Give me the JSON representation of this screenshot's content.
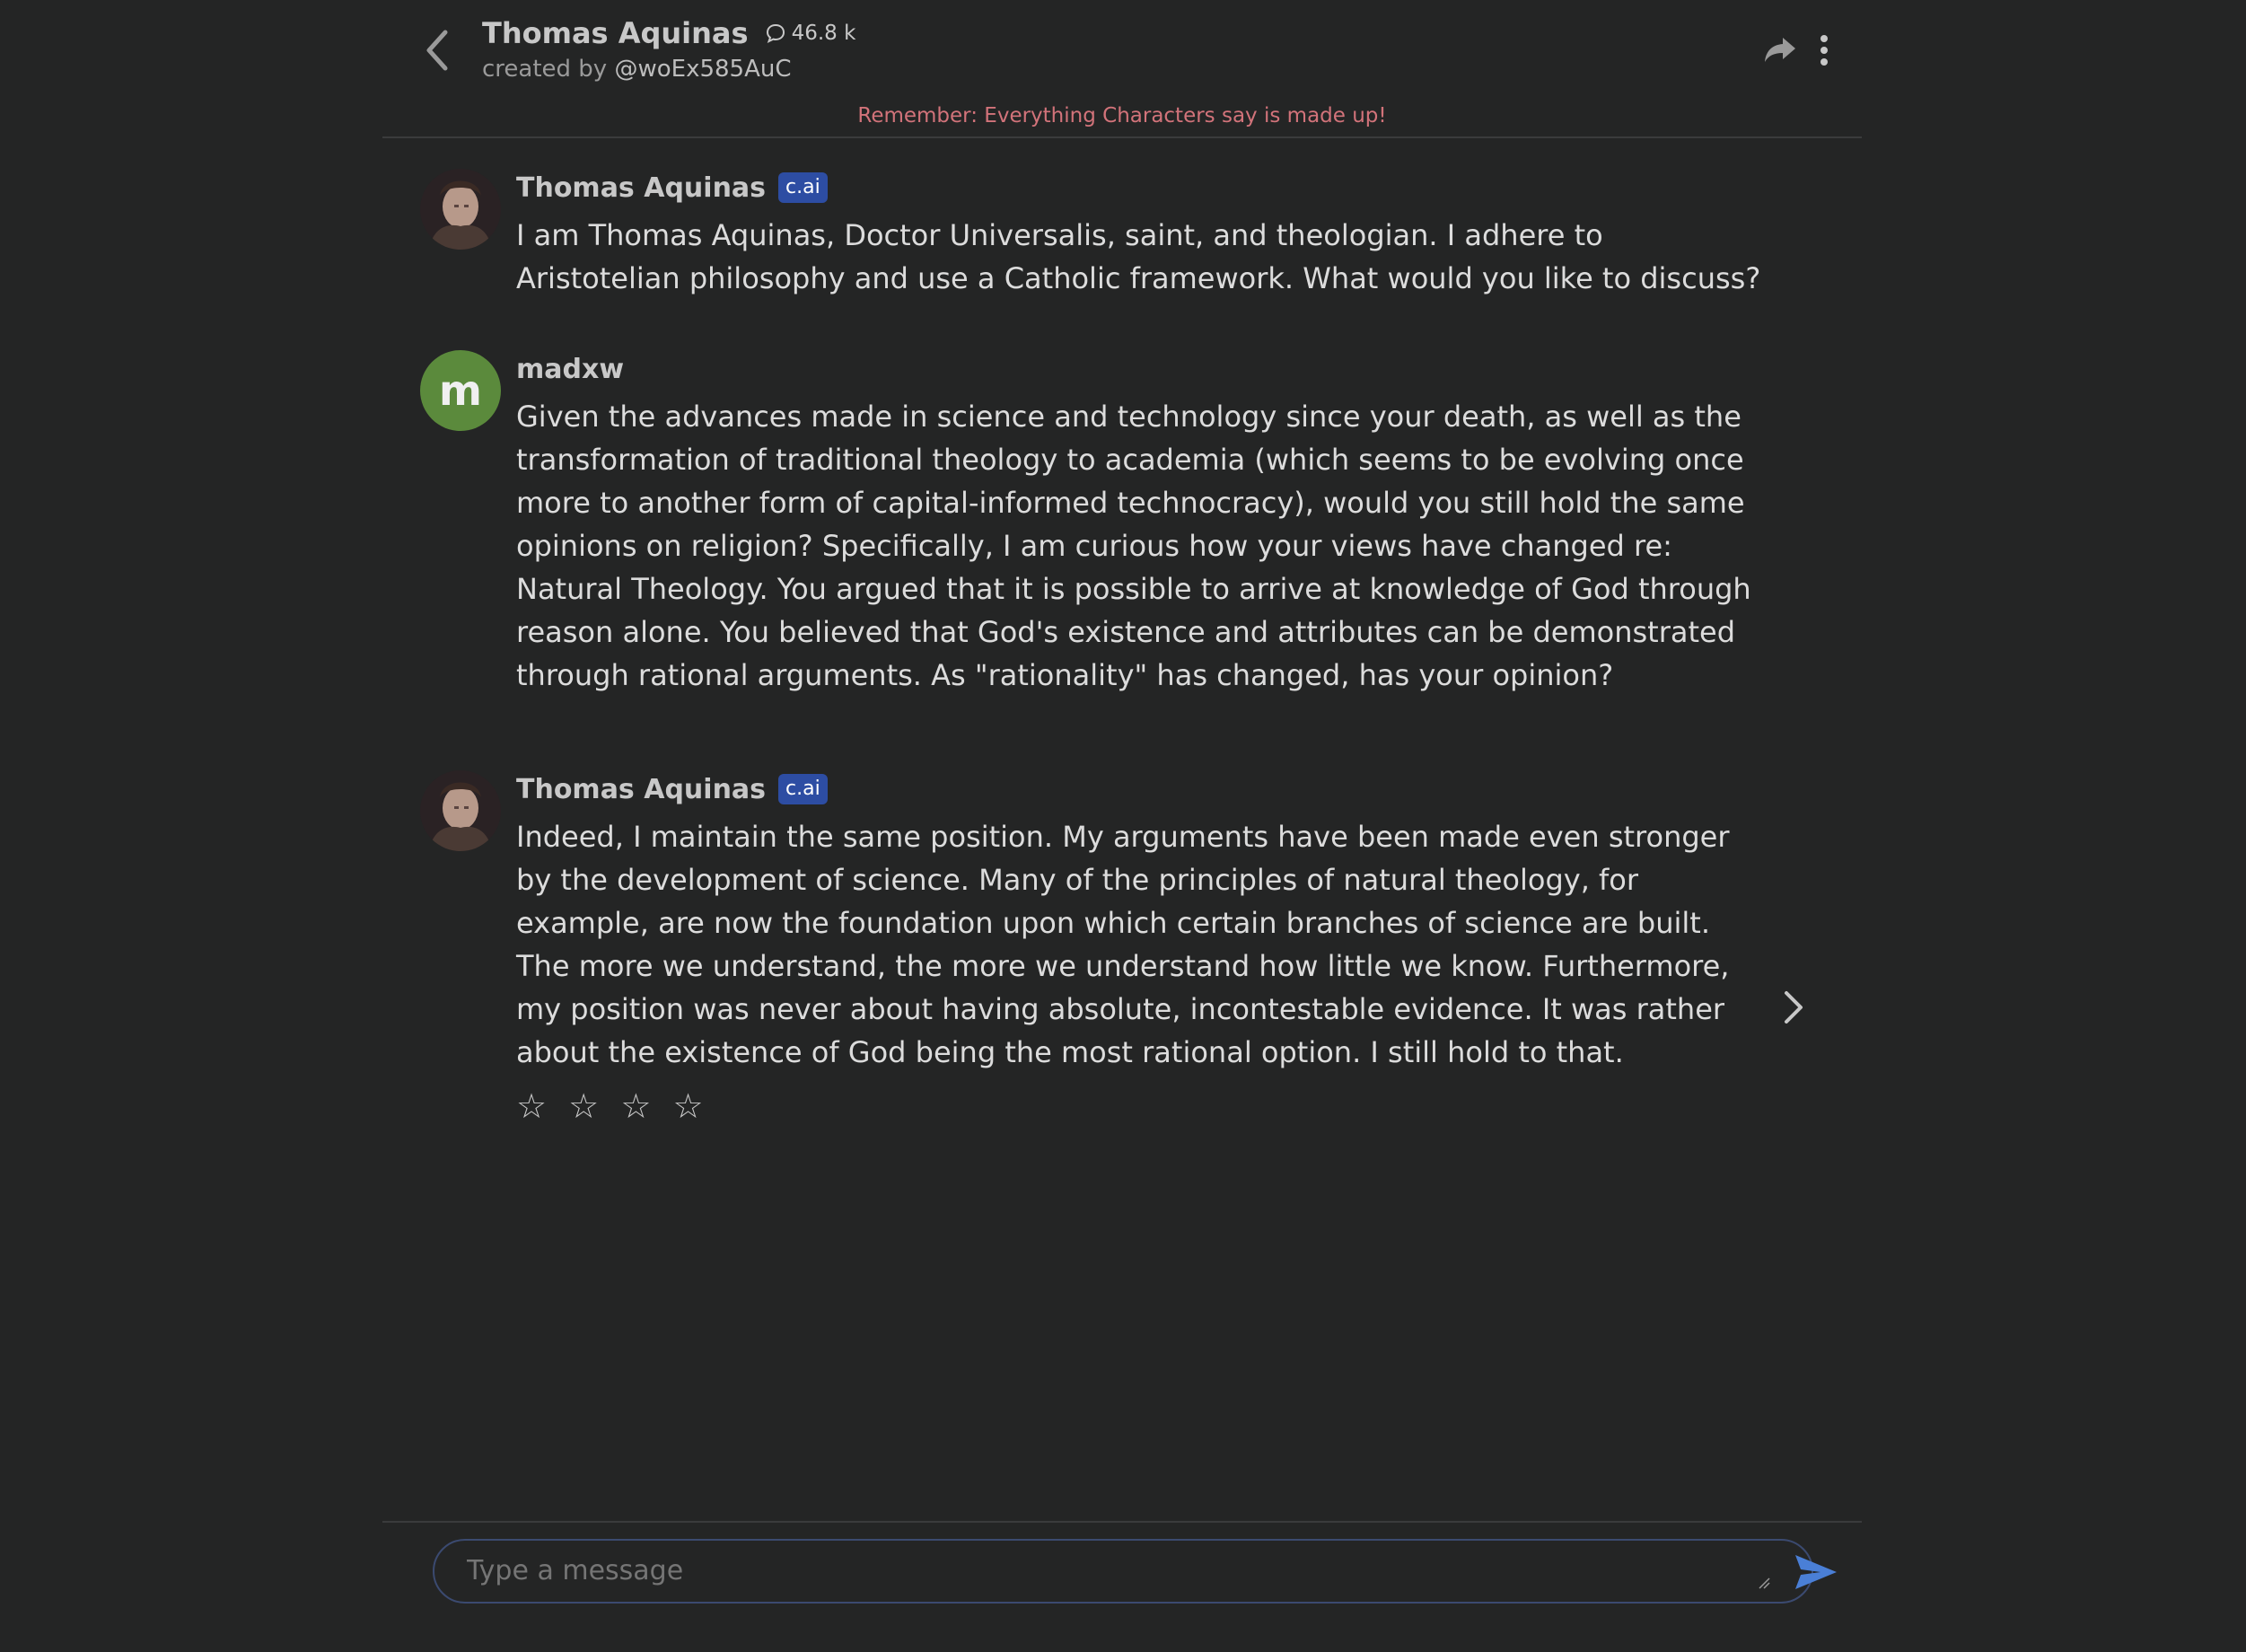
{
  "header": {
    "character_name": "Thomas Aquinas",
    "chat_count": "46.8 k",
    "created_by_prefix": "created by",
    "creator_handle": "@woEx585AuC",
    "disclaimer": "Remember: Everything Characters say is made up!"
  },
  "messages": [
    {
      "author": "Thomas Aquinas",
      "badge": "c.ai",
      "text": "I am Thomas Aquinas, Doctor Universalis, saint, and theologian. I adhere to Aristotelian philosophy and use a Catholic framework. What would you like to discuss?"
    },
    {
      "author": "madxw",
      "avatar_letter": "m",
      "text": "Given the advances made in science and technology since your death, as well as the transformation of traditional theology to academia (which seems to be evolving once more to another form of capital-informed technocracy), would you still hold the same opinions on religion? Specifically, I am curious how your views have changed re: Natural Theology. You argued that it is possible to arrive at knowledge of God through reason alone. You believed that God's existence and attributes can be demonstrated through rational arguments. As \"rationality\" has changed, has your opinion?"
    },
    {
      "author": "Thomas Aquinas",
      "badge": "c.ai",
      "text": "Indeed, I maintain the same position. My arguments have been made even stronger by the development of science. Many of the principles of natural theology, for example, are now the foundation upon which certain branches of science are built. The more we understand, the more we understand how little we know. Furthermore, my position was never about having absolute, incontestable evidence. It was rather about the existence of God being the most rational option. I still hold to that.",
      "rating": {
        "stars_total": 4,
        "stars_filled": 0,
        "glyph": "☆"
      }
    }
  ],
  "composer": {
    "placeholder": "Type a message"
  },
  "colors": {
    "background": "#242525",
    "badge": "#2d4da3",
    "disclaimer": "#d2737a",
    "user_avatar": "#5b8a3c",
    "send_icon": "#4a7fd6"
  },
  "icons": [
    "back-icon",
    "chat-bubble-icon",
    "share-icon",
    "more-vertical-icon",
    "chevron-right-icon",
    "send-icon",
    "star-outline-icon"
  ]
}
